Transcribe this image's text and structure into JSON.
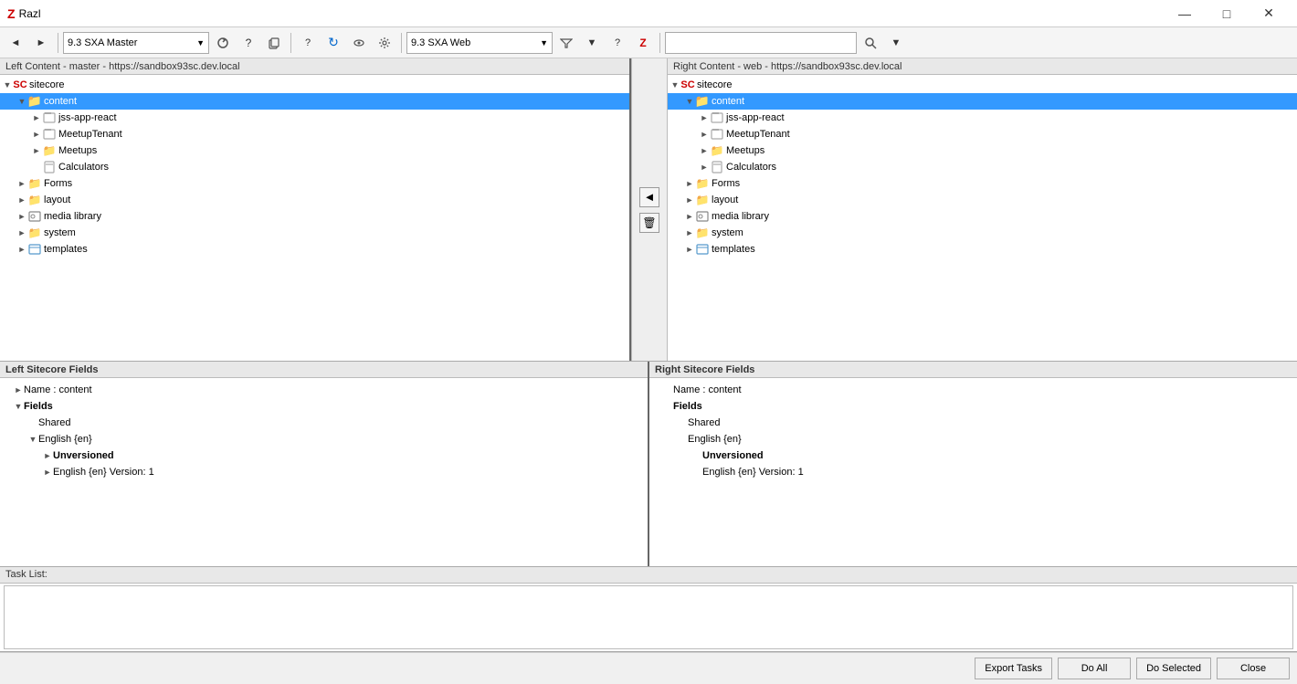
{
  "app": {
    "title": "Razl",
    "icon": "Z"
  },
  "titlebar": {
    "controls": {
      "minimize": "—",
      "maximize": "□",
      "close": "✕"
    }
  },
  "toolbar": {
    "left_dropdown": "9.3 SXA Master",
    "right_dropdown": "9.3 SXA Web",
    "search_placeholder": ""
  },
  "left_panel": {
    "header": "Left Content  -  master  -  https://sandbox93sc.dev.local",
    "tree": [
      {
        "id": "sitecore-l",
        "label": "sitecore",
        "level": 0,
        "expanded": true,
        "icon": "sitecore",
        "toggleState": "expanded"
      },
      {
        "id": "content-l",
        "label": "content",
        "level": 1,
        "expanded": true,
        "icon": "content",
        "toggleState": "expanded",
        "selected": true
      },
      {
        "id": "jss-app-l",
        "label": "jss-app-react",
        "level": 2,
        "expanded": false,
        "icon": "item",
        "toggleState": "collapsed"
      },
      {
        "id": "meetuptenant-l",
        "label": "MeetupTenant",
        "level": 2,
        "expanded": false,
        "icon": "item",
        "toggleState": "collapsed"
      },
      {
        "id": "meetups-l",
        "label": "Meetups",
        "level": 2,
        "expanded": false,
        "icon": "folder-orange",
        "toggleState": "collapsed"
      },
      {
        "id": "calculators-l",
        "label": "Calculators",
        "level": 2,
        "expanded": false,
        "icon": "calc",
        "toggleState": "leaf"
      },
      {
        "id": "forms-l",
        "label": "Forms",
        "level": 1,
        "expanded": false,
        "icon": "folder",
        "toggleState": "collapsed"
      },
      {
        "id": "layout-l",
        "label": "layout",
        "level": 1,
        "expanded": false,
        "icon": "folder-blue",
        "toggleState": "collapsed"
      },
      {
        "id": "media-l",
        "label": "media library",
        "level": 1,
        "expanded": false,
        "icon": "media",
        "toggleState": "collapsed"
      },
      {
        "id": "system-l",
        "label": "system",
        "level": 1,
        "expanded": false,
        "icon": "folder",
        "toggleState": "collapsed"
      },
      {
        "id": "templates-l",
        "label": "templates",
        "level": 1,
        "expanded": false,
        "icon": "template",
        "toggleState": "collapsed"
      }
    ]
  },
  "right_panel": {
    "header": "Right Content  -  web  -  https://sandbox93sc.dev.local",
    "tree": [
      {
        "id": "sitecore-r",
        "label": "sitecore",
        "level": 0,
        "expanded": true,
        "icon": "sitecore",
        "toggleState": "expanded"
      },
      {
        "id": "content-r",
        "label": "content",
        "level": 1,
        "expanded": true,
        "icon": "content",
        "toggleState": "expanded",
        "selected": true
      },
      {
        "id": "jss-app-r",
        "label": "jss-app-react",
        "level": 2,
        "expanded": false,
        "icon": "item",
        "toggleState": "collapsed"
      },
      {
        "id": "meetuptenant-r",
        "label": "MeetupTenant",
        "level": 2,
        "expanded": false,
        "icon": "item",
        "toggleState": "collapsed"
      },
      {
        "id": "meetups-r",
        "label": "Meetups",
        "level": 2,
        "expanded": false,
        "icon": "folder-orange",
        "toggleState": "collapsed"
      },
      {
        "id": "calculators-r",
        "label": "Calculators",
        "level": 2,
        "expanded": false,
        "icon": "calc",
        "toggleState": "collapsed"
      },
      {
        "id": "forms-r",
        "label": "Forms",
        "level": 1,
        "expanded": false,
        "icon": "folder",
        "toggleState": "collapsed"
      },
      {
        "id": "layout-r",
        "label": "layout",
        "level": 1,
        "expanded": false,
        "icon": "folder-blue",
        "toggleState": "collapsed"
      },
      {
        "id": "media-r",
        "label": "media library",
        "level": 1,
        "expanded": false,
        "icon": "media",
        "toggleState": "collapsed"
      },
      {
        "id": "system-r",
        "label": "system",
        "level": 1,
        "expanded": false,
        "icon": "folder",
        "toggleState": "collapsed"
      },
      {
        "id": "templates-r",
        "label": "templates",
        "level": 1,
        "expanded": false,
        "icon": "template",
        "toggleState": "collapsed"
      }
    ]
  },
  "left_fields": {
    "header": "Left Sitecore Fields",
    "fields": [
      {
        "id": "name-l",
        "label": "Name : content",
        "level": 0,
        "toggle": "collapsed",
        "bold": false
      },
      {
        "id": "fields-l",
        "label": "Fields",
        "level": 0,
        "toggle": "expanded",
        "bold": true
      },
      {
        "id": "shared-l",
        "label": "Shared",
        "level": 1,
        "toggle": "leaf",
        "bold": false
      },
      {
        "id": "english-l",
        "label": "English {en}",
        "level": 1,
        "toggle": "expanded",
        "bold": false
      },
      {
        "id": "unversioned-l",
        "label": "Unversioned",
        "level": 2,
        "toggle": "collapsed",
        "bold": true
      },
      {
        "id": "englishv-l",
        "label": "English {en} Version: 1",
        "level": 2,
        "toggle": "collapsed",
        "bold": false
      }
    ]
  },
  "right_fields": {
    "header": "Right Sitecore Fields",
    "fields": [
      {
        "id": "name-r",
        "label": "Name : content",
        "level": 0,
        "toggle": "none",
        "bold": false
      },
      {
        "id": "fields-r",
        "label": "Fields",
        "level": 0,
        "toggle": "none",
        "bold": true
      },
      {
        "id": "shared-r",
        "label": "Shared",
        "level": 1,
        "toggle": "none",
        "bold": false
      },
      {
        "id": "english-r",
        "label": "English {en}",
        "level": 1,
        "toggle": "none",
        "bold": false,
        "italic_suffix": " {en}"
      },
      {
        "id": "unversioned-r",
        "label": "Unversioned",
        "level": 2,
        "toggle": "none",
        "bold": true
      },
      {
        "id": "englishv-r",
        "label": "English {en} Version: 1",
        "level": 2,
        "toggle": "none",
        "bold": false
      }
    ]
  },
  "task_list": {
    "header": "Task List:",
    "items": []
  },
  "footer": {
    "export_tasks": "Export Tasks",
    "do_all": "Do All",
    "do_selected": "Do Selected",
    "close": "Close"
  },
  "center_controls": {
    "arrow_left": "◄",
    "trash": "🗑"
  }
}
